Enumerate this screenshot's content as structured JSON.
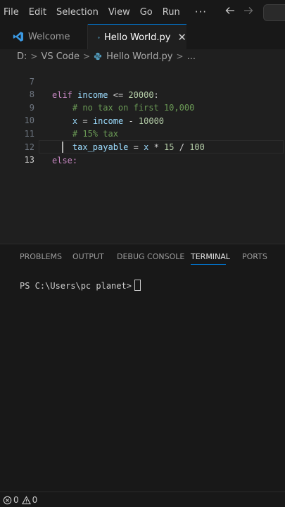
{
  "menubar": {
    "items": [
      "File",
      "Edit",
      "Selection",
      "View",
      "Go",
      "Run"
    ],
    "more": "···",
    "back_icon": "arrow-left-icon",
    "forward_icon": "arrow-right-icon"
  },
  "tabs": [
    {
      "label": "Welcome",
      "icon": "vscode-logo-icon",
      "active": false
    },
    {
      "label": "Hello World.py",
      "icon": "python-icon",
      "active": true,
      "close": "✕"
    }
  ],
  "breadcrumb": {
    "parts": [
      "D:",
      "VS Code",
      "Hello World.py",
      "..."
    ],
    "separator": ">"
  },
  "editor": {
    "lines": [
      {
        "num": "7",
        "text": "elif income <= 20000:"
      },
      {
        "num": "8",
        "text": "    # no tax on first 10,000"
      },
      {
        "num": "9",
        "text": "    x = income - 10000"
      },
      {
        "num": "10",
        "text": "    # 15% tax"
      },
      {
        "num": "11",
        "text": "    tax_payable = x * 15 / 100"
      },
      {
        "num": "12",
        "text": "else:"
      },
      {
        "num": "13",
        "text": ""
      }
    ],
    "active_line": "13"
  },
  "panel": {
    "tabs": [
      "PROBLEMS",
      "OUTPUT",
      "DEBUG CONSOLE",
      "TERMINAL",
      "PORTS"
    ],
    "active_tab": "TERMINAL",
    "terminal_prompt": "PS C:\\Users\\pc planet>"
  },
  "statusbar": {
    "errors": "0",
    "warnings": "0"
  },
  "colors": {
    "accent": "#0078d4",
    "python_icon": "#519aba",
    "vscode_icon": "#3b99e3"
  }
}
